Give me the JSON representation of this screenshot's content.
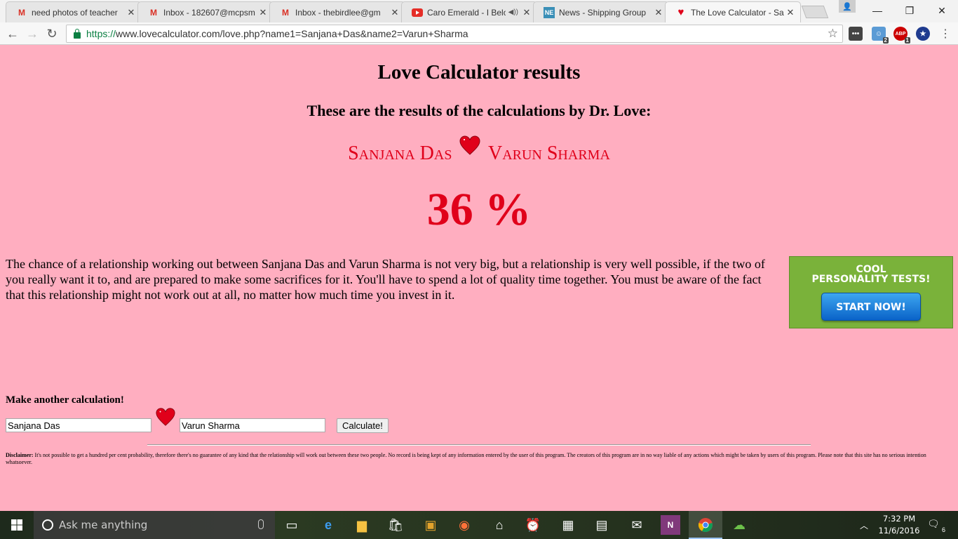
{
  "browser": {
    "tabs": [
      {
        "title": "need photos of teacher",
        "favicon": "gmail-icon"
      },
      {
        "title": "Inbox - 182607@mcpsm",
        "favicon": "gmail-icon"
      },
      {
        "title": "Inbox - thebirdlee@gm",
        "favicon": "gmail-icon"
      },
      {
        "title": "Caro Emerald - I Belo",
        "favicon": "youtube-icon"
      },
      {
        "title": "News - Shipping Group",
        "favicon": "ne-icon"
      },
      {
        "title": "The Love Calculator - Sa",
        "favicon": "heart-icon"
      }
    ],
    "url_scheme": "https://",
    "url_rest": "www.lovecalculator.com/love.php?name1=Sanjana+Das&name2=Varun+Sharma",
    "extension_badges": {
      "ext2": "2",
      "abp": "1"
    },
    "abp_label": "ABP"
  },
  "page": {
    "title": "Love Calculator results",
    "subtitle": "These are the results of the calculations by Dr. Love:",
    "name1": "Sanjana Das",
    "name2": "Varun Sharma",
    "percentage": "36 %",
    "result_text": "The chance of a relationship working out between Sanjana Das and Varun Sharma is not very big, but a relationship is very well possible, if the two of you really want it to, and are prepared to make some sacrifices for it. You'll have to spend a lot of quality time together. You must be aware of the fact that this relationship might not work out at all, no matter how much time you invest in it.",
    "ad": {
      "line1": "COOL",
      "line2": "PERSONALITY TESTS!",
      "button": "START NOW!"
    },
    "form": {
      "heading": "Make another calculation!",
      "name1_value": "Sanjana Das",
      "name2_value": "Varun Sharma",
      "button": "Calculate!"
    },
    "disclaimer_label": "Disclaimer:",
    "disclaimer_text": " It's not possible to get a hundred per cent probability, therefore there's no guarantee of any kind that the relationship will work out between these two people. No record is being kept of any information entered by the user of this program. The creators of this program are in no way liable of any actions which might be taken by users of this program. Please note that this site has no serious intention whatsoever."
  },
  "taskbar": {
    "search_placeholder": "Ask me anything",
    "time": "7:32 PM",
    "date": "11/6/2016",
    "notification_count": "6"
  },
  "colors": {
    "page_background": "#ffaec0",
    "accent_red": "#e0001a",
    "ad_green": "#7ab23a"
  }
}
